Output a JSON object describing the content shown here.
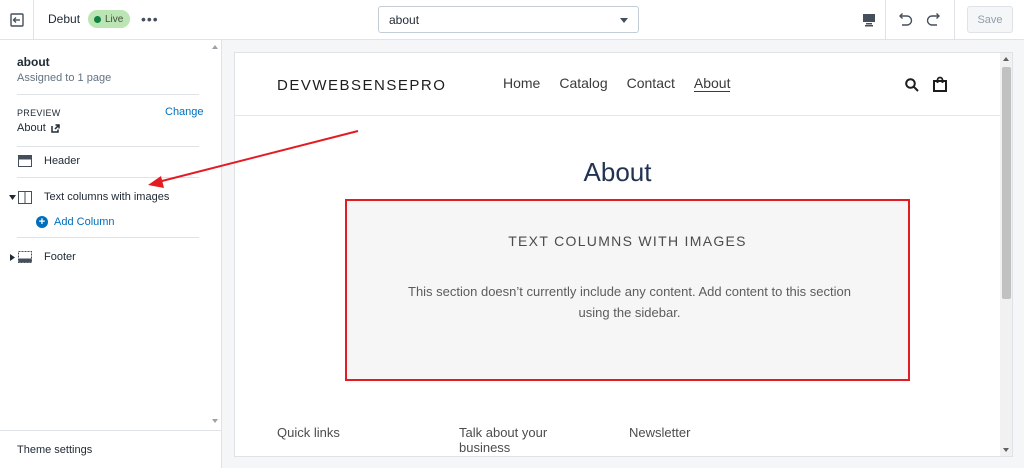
{
  "topbar": {
    "theme_name": "Debut",
    "status": "Live",
    "more_label": "•••",
    "page_select": "about",
    "save_label": "Save",
    "icons": [
      "exit-icon",
      "desktop-icon",
      "undo-icon",
      "redo-icon"
    ]
  },
  "sidebar": {
    "page_title": "about",
    "assigned": "Assigned to 1 page",
    "preview_label": "PREVIEW",
    "change_label": "Change",
    "preview_page": "About",
    "sections": [
      {
        "label": "Header",
        "icon": "header-icon"
      },
      {
        "label": "Text columns with images",
        "icon": "columns-icon",
        "expanded": true
      },
      {
        "label": "Footer",
        "icon": "footer-icon"
      }
    ],
    "add_column_label": "Add Column",
    "theme_settings_label": "Theme settings"
  },
  "store": {
    "logo": "DEVWEBSENSEPRO",
    "nav": [
      "Home",
      "Catalog",
      "Contact",
      "About"
    ],
    "active_nav": "About",
    "page_heading": "About",
    "section_heading": "TEXT COLUMNS WITH IMAGES",
    "section_text": "This section doesn’t currently include any content. Add content to this section using the sidebar.",
    "footer": [
      "Quick links",
      "Talk about your business",
      "Newsletter"
    ]
  },
  "colors": {
    "accent_link": "#006fbb",
    "live_badge": "#bbe5b3",
    "annotation_red": "#e31b23",
    "heading_navy": "#223352"
  }
}
